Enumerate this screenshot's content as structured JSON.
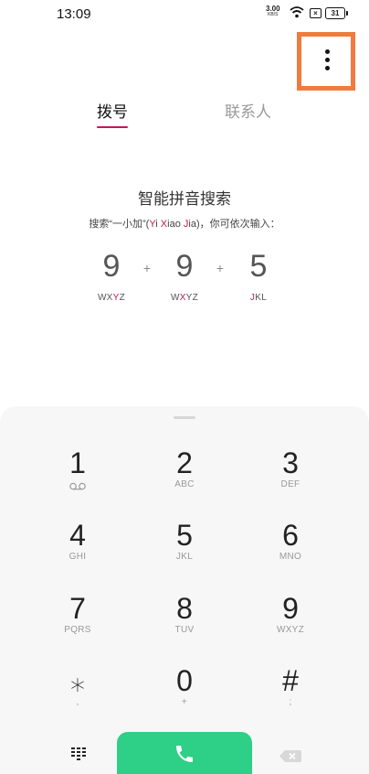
{
  "status_bar": {
    "time": "13:09",
    "net_speed": "3.00",
    "net_speed_unit": "KB/S",
    "battery": "31",
    "icons": [
      "wifi-icon",
      "no-sim-icon",
      "battery-icon"
    ]
  },
  "tabs": [
    {
      "label": "拨号",
      "active": true
    },
    {
      "label": "联系人",
      "active": false
    }
  ],
  "hint": {
    "title": "智能拼音搜索",
    "sub_prefix": "搜索“一小加”(",
    "sub_Y": "Y",
    "sub_i": "i ",
    "sub_X": "X",
    "sub_iao": "iao ",
    "sub_J": "J",
    "sub_ia": "ia",
    "sub_suffix": ")，你可依次输入："
  },
  "example": {
    "digits": [
      "9",
      "9",
      "5"
    ],
    "plus": "+",
    "letters": [
      {
        "pre": "WX",
        "hl": "Y",
        "post": "Z"
      },
      {
        "pre": "W",
        "hl": "X",
        "post": "YZ"
      },
      {
        "pre": "",
        "hl": "J",
        "post": "KL"
      }
    ]
  },
  "keypad": [
    {
      "num": "1",
      "sub": "voicemail-icon"
    },
    {
      "num": "2",
      "sub": "ABC"
    },
    {
      "num": "3",
      "sub": "DEF"
    },
    {
      "num": "4",
      "sub": "GHI"
    },
    {
      "num": "5",
      "sub": "JKL"
    },
    {
      "num": "6",
      "sub": "MNO"
    },
    {
      "num": "7",
      "sub": "PQRS"
    },
    {
      "num": "8",
      "sub": "TUV"
    },
    {
      "num": "9",
      "sub": "WXYZ"
    },
    {
      "num": "⁎",
      "sub": ","
    },
    {
      "num": "0",
      "sub": "+"
    },
    {
      "num": "#",
      "sub": ";"
    }
  ],
  "colors": {
    "accent": "#c2185b",
    "call_green": "#2ecf86",
    "highlight_box": "#f07b3f",
    "keypad_bg": "#f7f7f7"
  }
}
